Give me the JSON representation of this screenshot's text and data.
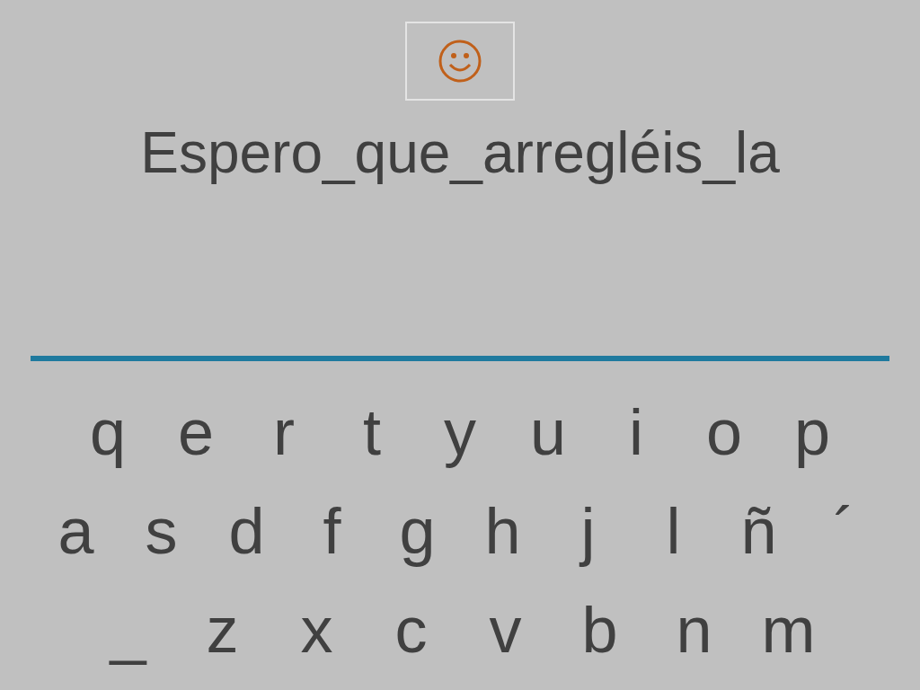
{
  "sentence": "Espero_que_arregléis_la",
  "keyboard_rows": [
    [
      "q",
      "e",
      "r",
      "t",
      "y",
      "u",
      "i",
      "o",
      "p"
    ],
    [
      "a",
      "s",
      "d",
      "f",
      "g",
      "h",
      "j",
      "l",
      "ñ",
      "´"
    ],
    [
      "_",
      "z",
      "x",
      "c",
      "v",
      "b",
      "n",
      "m"
    ]
  ]
}
